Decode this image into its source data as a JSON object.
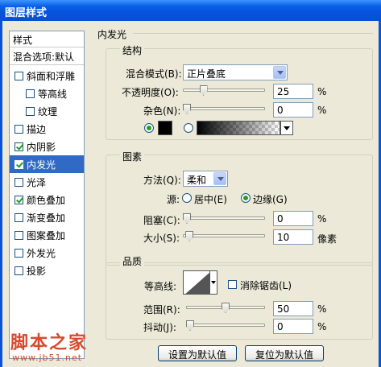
{
  "window": {
    "title": "图层样式"
  },
  "sidebar": {
    "header": "样式",
    "blend_options": "混合选项:默认",
    "items": [
      {
        "label": "斜面和浮雕",
        "checked": false,
        "sub": false,
        "selected": false
      },
      {
        "label": "等高线",
        "checked": false,
        "sub": true,
        "selected": false
      },
      {
        "label": "纹理",
        "checked": false,
        "sub": true,
        "selected": false
      },
      {
        "label": "描边",
        "checked": false,
        "sub": false,
        "selected": false
      },
      {
        "label": "内阴影",
        "checked": true,
        "sub": false,
        "selected": false
      },
      {
        "label": "内发光",
        "checked": true,
        "sub": false,
        "selected": true
      },
      {
        "label": "光泽",
        "checked": false,
        "sub": false,
        "selected": false
      },
      {
        "label": "颜色叠加",
        "checked": true,
        "sub": false,
        "selected": false
      },
      {
        "label": "渐变叠加",
        "checked": false,
        "sub": false,
        "selected": false
      },
      {
        "label": "图案叠加",
        "checked": false,
        "sub": false,
        "selected": false
      },
      {
        "label": "外发光",
        "checked": false,
        "sub": false,
        "selected": false
      },
      {
        "label": "投影",
        "checked": false,
        "sub": false,
        "selected": false
      }
    ]
  },
  "panel": {
    "title": "内发光",
    "structure": {
      "legend": "结构",
      "blend_mode_label": "混合模式(B):",
      "blend_mode_value": "正片叠底",
      "opacity_label": "不透明度(O):",
      "opacity_value": "25",
      "opacity_unit": "%",
      "noise_label": "杂色(N):",
      "noise_value": "0",
      "noise_unit": "%",
      "solid_color": "#000000",
      "color_mode": "solid"
    },
    "elements": {
      "legend": "图素",
      "method_label": "方法(Q):",
      "method_value": "柔和",
      "source_label": "源:",
      "source_center": "居中(E)",
      "source_edge": "边缘(G)",
      "source_selected": "edge",
      "choke_label": "阻塞(C):",
      "choke_value": "0",
      "choke_unit": "%",
      "size_label": "大小(S):",
      "size_value": "10",
      "size_unit": "像素"
    },
    "quality": {
      "legend": "品质",
      "contour_label": "等高线:",
      "antialias_label": "消除锯齿(L)",
      "antialias_checked": false,
      "range_label": "范围(R):",
      "range_value": "50",
      "range_unit": "%",
      "jitter_label": "抖动(J):",
      "jitter_value": "0",
      "jitter_unit": "%"
    },
    "buttons": {
      "set_default": "设置为默认值",
      "reset_default": "复位为默认值"
    }
  },
  "watermark": {
    "text": "脚本之家",
    "url": "www.jb51.net"
  }
}
